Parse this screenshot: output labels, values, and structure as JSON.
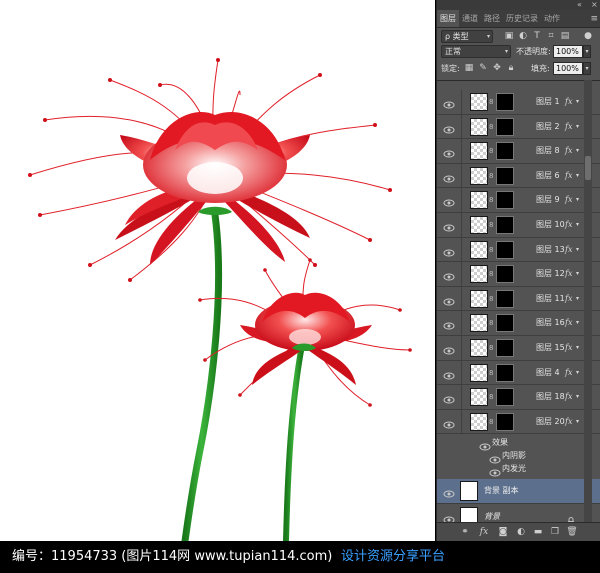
{
  "app": "Photoshop",
  "panel": {
    "tabs": [
      {
        "label": "图层",
        "active": true
      },
      {
        "label": "通道",
        "active": false
      },
      {
        "label": "路径",
        "active": false
      },
      {
        "label": "历史记录",
        "active": false
      },
      {
        "label": "动作",
        "active": false
      }
    ],
    "filter_kind": "ρ 类型",
    "blend_mode": "正常",
    "opacity_label": "不透明度:",
    "opacity_value": "100%",
    "lock_label": "锁定:",
    "fill_label": "填充:",
    "fill_value": "100%",
    "layers": [
      {
        "name": "图层 1",
        "has_fx": true
      },
      {
        "name": "图层 2",
        "has_fx": true
      },
      {
        "name": "图层 8",
        "has_fx": true
      },
      {
        "name": "图层 6",
        "has_fx": true
      },
      {
        "name": "图层 9",
        "has_fx": true
      },
      {
        "name": "图层 10",
        "has_fx": true
      },
      {
        "name": "图层 13",
        "has_fx": true
      },
      {
        "name": "图层 12",
        "has_fx": true
      },
      {
        "name": "图层 11",
        "has_fx": true
      },
      {
        "name": "图层 16",
        "has_fx": true
      },
      {
        "name": "图层 15",
        "has_fx": true
      },
      {
        "name": "图层 4",
        "has_fx": true
      },
      {
        "name": "图层 18",
        "has_fx": true
      },
      {
        "name": "图层 20",
        "has_fx": true
      }
    ],
    "effects": {
      "header": "效果",
      "items": [
        "内阴影",
        "内发光"
      ]
    },
    "background_copy": {
      "name": "背景 副本",
      "selected": true
    },
    "background": {
      "name": "背景",
      "locked": true
    },
    "fx_label": "fx",
    "footer_icons": [
      "link-icon",
      "fx-icon",
      "mask-icon",
      "adjustment-icon",
      "folder-icon",
      "new-layer-icon",
      "trash-icon"
    ]
  },
  "watermark": {
    "left_text": "编号：11954733 (图片114网 www.tupian114.com)",
    "right_text": "设计资源分享平台",
    "right_color": "#3aa0ff"
  },
  "colors": {
    "petal_red": "#e0101a",
    "stem_green": "#2a9a2a",
    "panel_bg": "#535353",
    "selected_layer": "#5c6f8c"
  }
}
